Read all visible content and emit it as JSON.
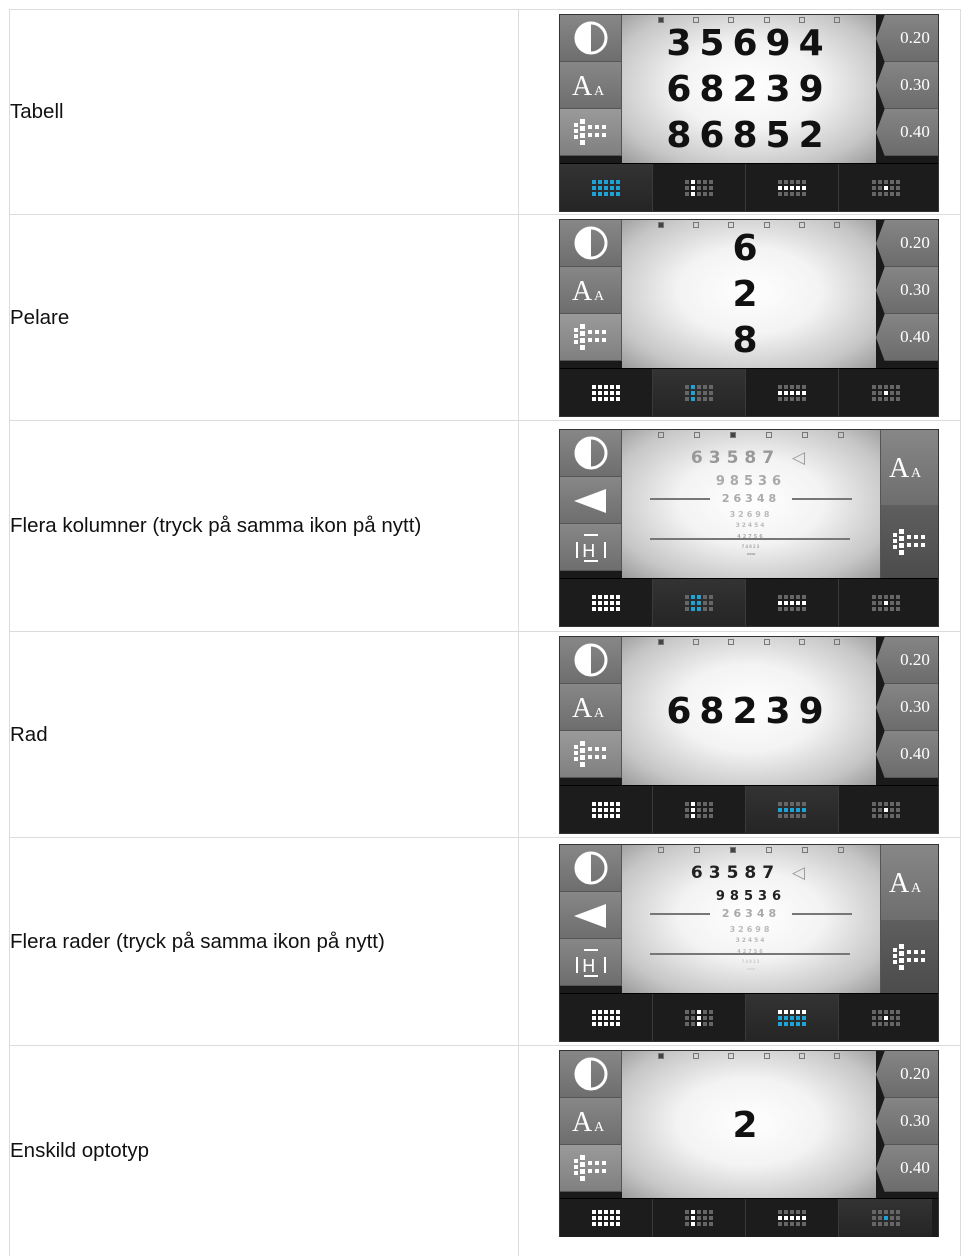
{
  "rows": [
    {
      "label": "Tabell",
      "mode": "table",
      "lines": [
        "35694",
        "68239",
        "86852"
      ],
      "acuity": [
        "0.20",
        "0.30",
        "0.40"
      ],
      "selected_tab": 0
    },
    {
      "label": "Pelare",
      "mode": "column",
      "lines": [
        "6",
        "2",
        "8"
      ],
      "acuity": [
        "0.20",
        "0.30",
        "0.40"
      ],
      "selected_tab": 1
    },
    {
      "label": "Flera kolumner (tryck på samma ikon på nytt)",
      "mode": "multi-column",
      "lines": [
        "63587",
        "98536",
        "26348",
        "32698",
        "32454",
        "42756",
        "74823",
        "2316"
      ],
      "selected_tab": 1,
      "font_button": "A"
    },
    {
      "label": "Rad",
      "mode": "row",
      "lines": [
        "68239"
      ],
      "acuity": [
        "0.20",
        "0.30",
        "0.40"
      ],
      "selected_tab": 2
    },
    {
      "label": "Flera rader (tryck på samma ikon på nytt)",
      "mode": "multi-row",
      "lines": [
        "63587",
        "98536",
        "26348",
        "32698",
        "32454",
        "42756",
        "74823",
        "2316"
      ],
      "selected_tab": 2,
      "font_button": "A"
    },
    {
      "label": "Enskild optotyp",
      "mode": "single",
      "lines": [
        "2"
      ],
      "acuity": [
        "0.20",
        "0.30",
        "0.40"
      ],
      "selected_tab": 3
    }
  ],
  "icons": {
    "contrast": "contrast-icon",
    "font": "font-size-icon",
    "layout": "layout-grid-icon",
    "back": "back-arrow-icon",
    "h": "h-letter-icon"
  },
  "colors": {
    "accent": "#1ea3d6",
    "panel": "#7a7a7a",
    "bar": "#1c1c1c"
  }
}
